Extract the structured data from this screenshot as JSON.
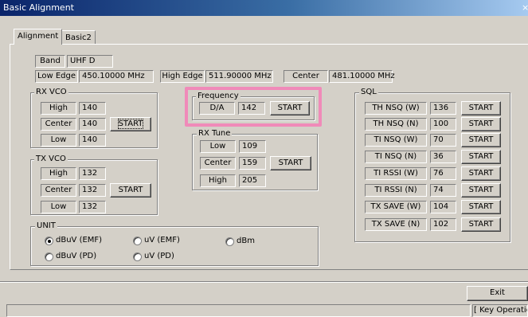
{
  "window": {
    "title": "Basic Alignment",
    "close_glyph": "×"
  },
  "tabs": [
    {
      "label": "Alignment"
    },
    {
      "label": "Basic2"
    }
  ],
  "band": {
    "label": "Band",
    "value": "UHF D"
  },
  "edges": {
    "low_label": "Low Edge",
    "low_value": "450.10000 MHz",
    "high_label": "High Edge",
    "high_value": "511.90000 MHz",
    "center_label": "Center",
    "center_value": "481.10000 MHz"
  },
  "rx_vco": {
    "title": "RX VCO",
    "high_label": "High",
    "high_value": "140",
    "center_label": "Center",
    "center_value": "140",
    "low_label": "Low",
    "low_value": "140",
    "start_label": "START"
  },
  "tx_vco": {
    "title": "TX VCO",
    "high_label": "High",
    "high_value": "132",
    "center_label": "Center",
    "center_value": "132",
    "low_label": "Low",
    "low_value": "132",
    "start_label": "START"
  },
  "frequency": {
    "title": "Frequency",
    "da_label": "D/A",
    "da_value": "142",
    "start_label": "START"
  },
  "rx_tune": {
    "title": "RX Tune",
    "low_label": "Low",
    "low_value": "109",
    "center_label": "Center",
    "center_value": "159",
    "high_label": "High",
    "high_value": "205",
    "start_label": "START"
  },
  "sql": {
    "title": "SQL",
    "rows": [
      {
        "label": "TH NSQ (W)",
        "value": "136",
        "button": "START"
      },
      {
        "label": "TH NSQ (N)",
        "value": "100",
        "button": "START"
      },
      {
        "label": "TI NSQ (W)",
        "value": "70",
        "button": "START"
      },
      {
        "label": "TI NSQ (N)",
        "value": "36",
        "button": "START"
      },
      {
        "label": "TI RSSI (W)",
        "value": "76",
        "button": "START"
      },
      {
        "label": "TI RSSI (N)",
        "value": "74",
        "button": "START"
      },
      {
        "label": "TX SAVE (W)",
        "value": "104",
        "button": "START"
      },
      {
        "label": "TX SAVE (N)",
        "value": "102",
        "button": "START"
      }
    ]
  },
  "unit": {
    "title": "UNIT",
    "options": [
      {
        "label": "dBuV (EMF)",
        "selected": true
      },
      {
        "label": "uV (EMF)",
        "selected": false
      },
      {
        "label": "dBm",
        "selected": false
      },
      {
        "label": "dBuV (PD)",
        "selected": false
      },
      {
        "label": "uV (PD)",
        "selected": false
      }
    ]
  },
  "exit_label": "Exit",
  "status_bar": {
    "key_operation": "[ Key Operation"
  },
  "colors": {
    "highlight": "#f08ab9",
    "titlebar": "#0a246a",
    "face": "#d4d0c8"
  }
}
